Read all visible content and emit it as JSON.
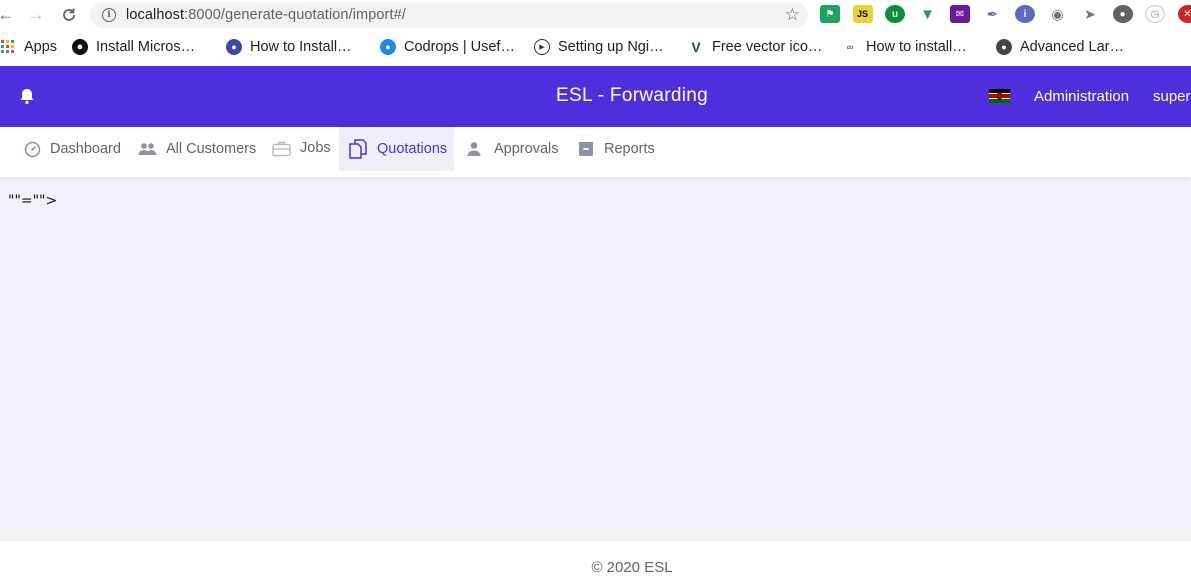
{
  "browser": {
    "url_host": "localhost",
    "url_rest": ":8000/generate-quotation/import#/",
    "extensions": [
      "flag-ext-icon",
      "js-ext-icon",
      "shield-ext-icon",
      "vue-ext-icon",
      "mail-ext-icon",
      "picker-ext-icon",
      "circle-ext-icon",
      "camera-ext-icon",
      "arrow-ext-icon",
      "record-ext-icon",
      "clock-ext-icon",
      "adblock-ext-icon"
    ]
  },
  "bookmarks": [
    {
      "label": "Apps",
      "icon": "apps-grid-icon"
    },
    {
      "label": "Install Micros…",
      "icon": "github-icon"
    },
    {
      "label": "How to Install…",
      "icon": "bookmark-site-icon"
    },
    {
      "label": "Codrops | Usef…",
      "icon": "codrops-icon"
    },
    {
      "label": "Setting up Ngi…",
      "icon": "play-circle-icon"
    },
    {
      "label": "Free vector ico…",
      "icon": "vector-icon"
    },
    {
      "label": "How to install…",
      "icon": "link-icon"
    },
    {
      "label": "Advanced Lar…",
      "icon": "globe-icon"
    }
  ],
  "header": {
    "title": "ESL - Forwarding",
    "admin_label": "Administration",
    "user_label": "super"
  },
  "nav": {
    "items": [
      {
        "label": "Dashboard",
        "icon": "dashboard-icon"
      },
      {
        "label": "All Customers",
        "icon": "people-icon"
      },
      {
        "label": "Jobs",
        "icon": "briefcase-icon"
      },
      {
        "label": "Quotations",
        "icon": "documents-icon"
      },
      {
        "label": "Approvals",
        "icon": "person-icon"
      },
      {
        "label": "Reports",
        "icon": "archive-icon"
      }
    ],
    "active": "Quotations"
  },
  "main": {
    "stray_text": "\"\"=\"\">"
  },
  "footer": {
    "copyright": "© 2020 ESL"
  },
  "colors": {
    "brand": "#4f2fdc",
    "content_bg": "#eff2f9",
    "nav_text": "#5b6478"
  }
}
